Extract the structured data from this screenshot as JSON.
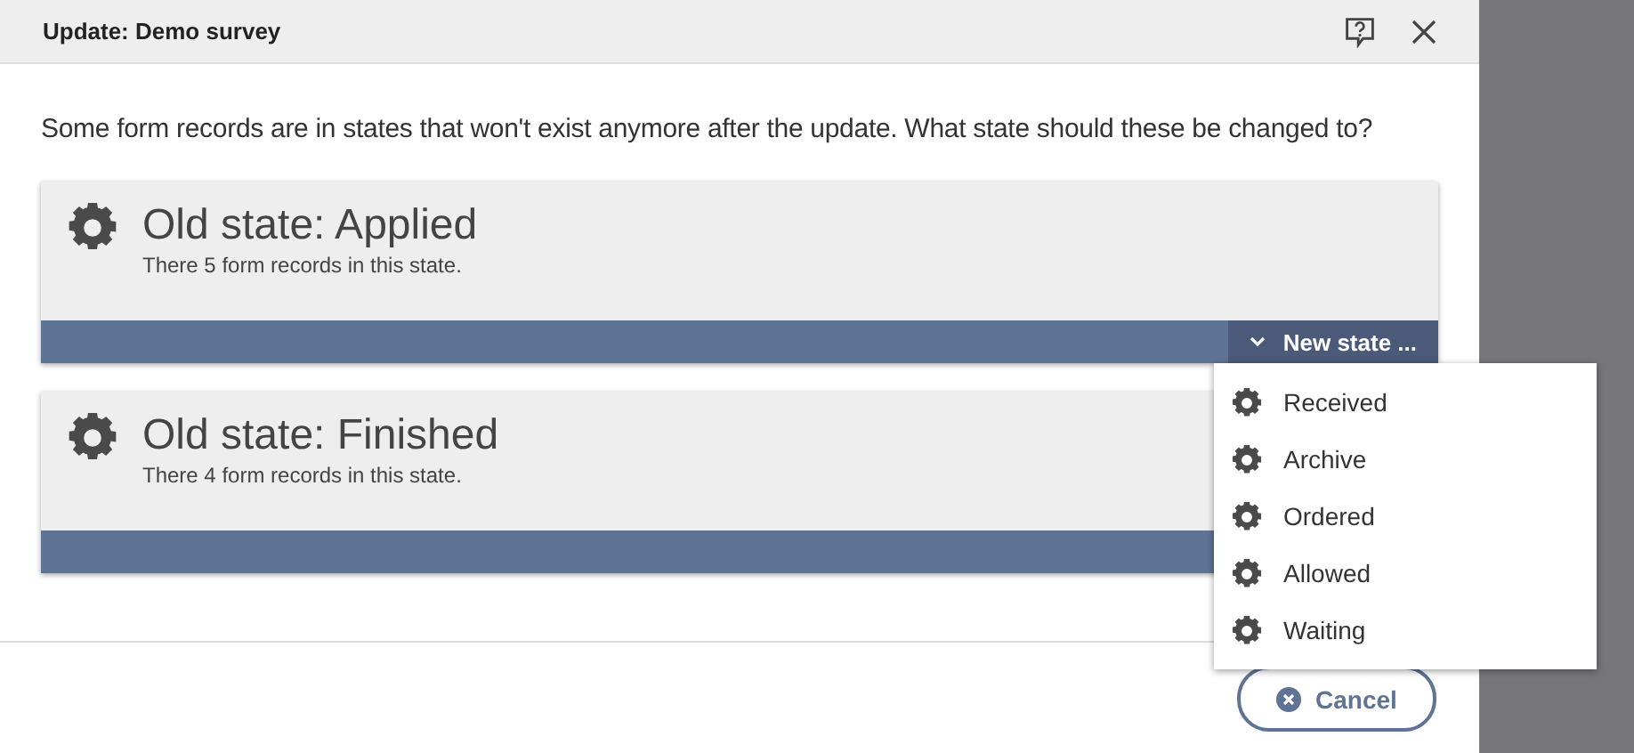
{
  "dialog": {
    "title": "Update: Demo survey",
    "message": "Some form records are in states that won't exist anymore after the update. What state should these be changed to?"
  },
  "states": [
    {
      "title": "Old state: Applied",
      "subtitle": "There 5 form records in this state.",
      "button": {
        "label": "New state ...",
        "active": true
      }
    },
    {
      "title": "Old state: Finished",
      "subtitle": "There 4 form records in this state."
    }
  ],
  "menu": {
    "items": [
      {
        "label": "Received"
      },
      {
        "label": "Archive"
      },
      {
        "label": "Ordered"
      },
      {
        "label": "Allowed"
      },
      {
        "label": "Waiting"
      }
    ]
  },
  "buttons": [
    {
      "label": "Cancel"
    }
  ]
}
